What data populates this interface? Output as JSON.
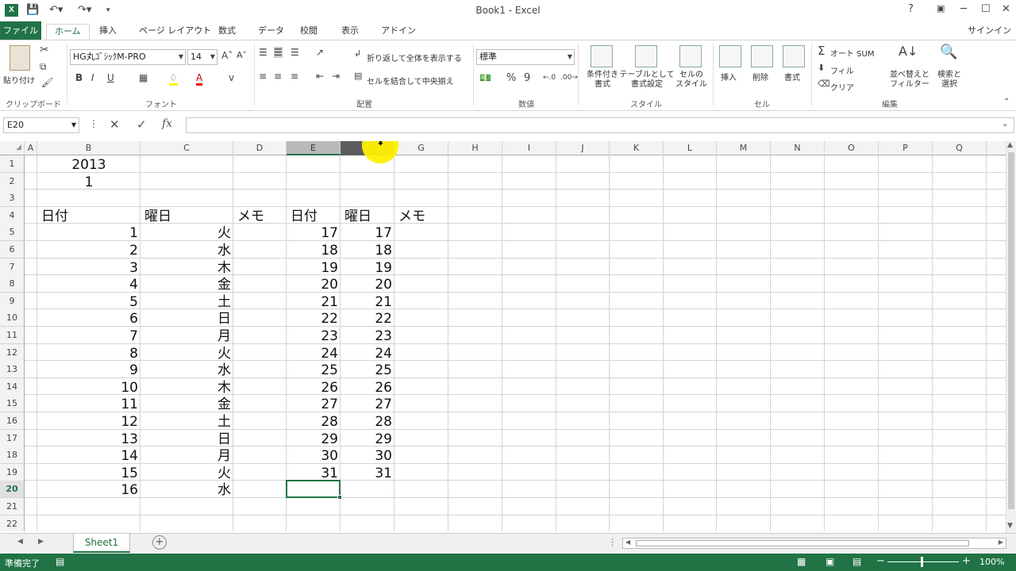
{
  "window": {
    "app_icon": "X",
    "title": "Book1 - Excel",
    "help": "?",
    "restore_icon": "ribbon-display-icon",
    "minimize": "─",
    "maximize": "☐",
    "close": "✕"
  },
  "qat": {
    "save_icon": "save-icon",
    "undo_icon": "undo-icon",
    "redo_icon": "redo-icon"
  },
  "tabs": [
    "ファイル",
    "ホーム",
    "挿入",
    "ページ レイアウト",
    "数式",
    "データ",
    "校閲",
    "表示",
    "アドイン"
  ],
  "active_tab": "ホーム",
  "signin": "サインイン",
  "ribbon": {
    "clipboard": {
      "paste": "貼り付け",
      "label": "クリップボード"
    },
    "font": {
      "font_name": "HG丸ｺﾞｼｯｸM-PRO",
      "font_size": "14",
      "bold": "B",
      "italic": "I",
      "underline": "U",
      "label": "フォント"
    },
    "alignment": {
      "wrap": "折り返して全体を表示する",
      "merge": "セルを結合して中央揃え",
      "label": "配置"
    },
    "number": {
      "format": "標準",
      "percent": "%",
      "comma": "9",
      "label": "数値"
    },
    "styles": {
      "conditional": "条件付き\n書式",
      "table": "テーブルとして\n書式設定",
      "cell_style": "セルの\nスタイル",
      "label": "スタイル"
    },
    "cells": {
      "insert": "挿入",
      "delete": "削除",
      "format": "書式",
      "label": "セル"
    },
    "editing": {
      "autosum": "オート SUM",
      "fill": "フィル",
      "clear": "クリア",
      "sort": "並べ替えと\nフィルター",
      "find": "検索と\n選択",
      "label": "編集"
    }
  },
  "formula_bar": {
    "name_box": "E20",
    "cancel": "✕",
    "enter": "✓",
    "fx": "fx",
    "value": ""
  },
  "columns": [
    "A",
    "B",
    "C",
    "D",
    "E",
    "F",
    "G",
    "H",
    "I",
    "J",
    "K",
    "L",
    "M",
    "N",
    "O",
    "P",
    "Q"
  ],
  "rows": [
    "1",
    "2",
    "3",
    "4",
    "5",
    "6",
    "7",
    "8",
    "9",
    "10",
    "11",
    "12",
    "13",
    "14",
    "15",
    "16",
    "17",
    "18",
    "19",
    "20",
    "21",
    "22"
  ],
  "cells": {
    "B1": "2013",
    "B2": "1",
    "B4": "日付",
    "C4": "曜日",
    "D4": "メモ",
    "E4": "日付",
    "F4": "曜日",
    "G4": "メモ",
    "B5": "1",
    "C5": "火",
    "E5": "17",
    "F5": "17",
    "B6": "2",
    "C6": "水",
    "E6": "18",
    "F6": "18",
    "B7": "3",
    "C7": "木",
    "E7": "19",
    "F7": "19",
    "B8": "4",
    "C8": "金",
    "E8": "20",
    "F8": "20",
    "B9": "5",
    "C9": "土",
    "E9": "21",
    "F9": "21",
    "B10": "6",
    "C10": "日",
    "E10": "22",
    "F10": "22",
    "B11": "7",
    "C11": "月",
    "E11": "23",
    "F11": "23",
    "B12": "8",
    "C12": "火",
    "E12": "24",
    "F12": "24",
    "B13": "9",
    "C13": "水",
    "E13": "25",
    "F13": "25",
    "B14": "10",
    "C14": "木",
    "E14": "26",
    "F14": "26",
    "B15": "11",
    "C15": "金",
    "E15": "27",
    "F15": "27",
    "B16": "12",
    "C16": "土",
    "E16": "28",
    "F16": "28",
    "B17": "13",
    "C17": "日",
    "E17": "29",
    "F17": "29",
    "B18": "14",
    "C18": "月",
    "E18": "30",
    "F18": "30",
    "B19": "15",
    "C19": "火",
    "E19": "31",
    "F19": "31",
    "B20": "16",
    "C20": "水"
  },
  "selected_cell": "E20",
  "sheet_tabs": {
    "prev": "◀",
    "next": "▶",
    "sheet1": "Sheet1",
    "add": "+"
  },
  "status": {
    "ready": "準備完了",
    "zoom": "100%"
  },
  "colors": {
    "accent": "#217346",
    "highlight": "#ffee00"
  }
}
